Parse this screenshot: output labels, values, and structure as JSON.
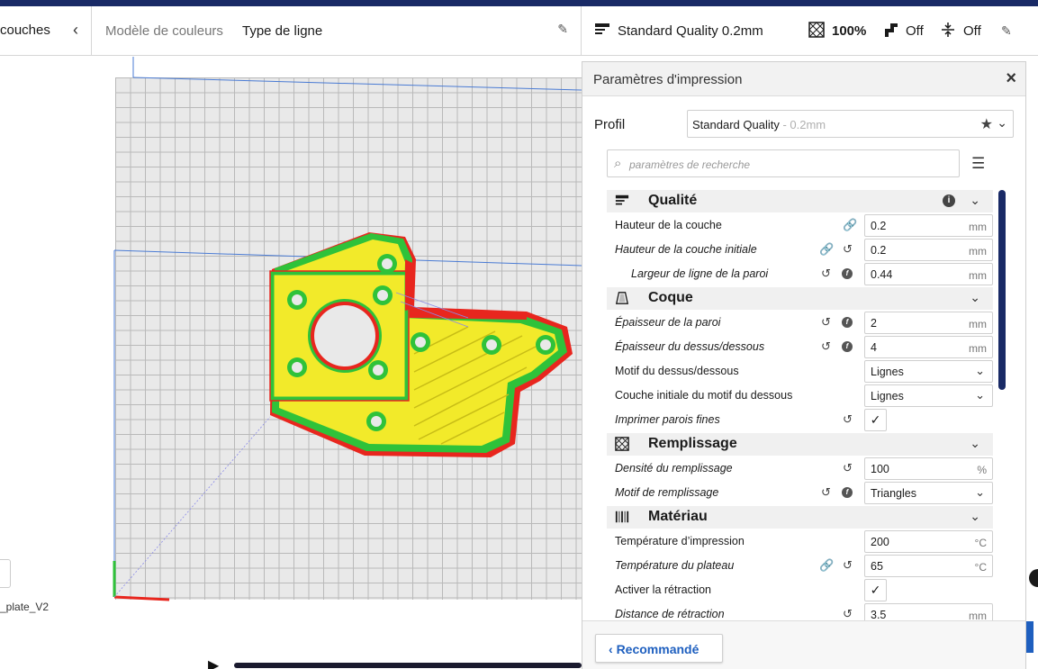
{
  "topbar": {
    "left_label": "couches",
    "color_scheme_label": "Modèle de couleurs",
    "color_scheme_value": "Type de ligne",
    "profile_label": "Standard Quality 0.2mm",
    "infill_value": "100%",
    "support_value": "Off",
    "adhesion_value": "Off"
  },
  "viewport": {
    "filename": "_plate_V2"
  },
  "panel": {
    "title": "Paramètres d'impression",
    "profil_label": "Profil",
    "profil_name": "Standard Quality",
    "profil_suffix": " - 0.2mm",
    "search_placeholder": "paramètres de recherche",
    "footer_button": "Recommandé"
  },
  "settings": {
    "qualite": {
      "label": "Qualité",
      "rows": [
        {
          "label": "Hauteur de la couche",
          "value": "0.2",
          "unit": "mm"
        },
        {
          "label": "Hauteur de la couche initiale",
          "value": "0.2",
          "unit": "mm"
        },
        {
          "label": "Largeur de ligne de la paroi",
          "value": "0.44",
          "unit": "mm"
        }
      ]
    },
    "coque": {
      "label": "Coque",
      "rows": [
        {
          "label": "Épaisseur de la paroi",
          "value": "2",
          "unit": "mm"
        },
        {
          "label": "Épaisseur du dessus/dessous",
          "value": "4",
          "unit": "mm"
        },
        {
          "label": "Motif du dessus/dessous",
          "value": "Lignes"
        },
        {
          "label": "Couche initiale du motif du dessous",
          "value": "Lignes"
        },
        {
          "label": "Imprimer parois fines",
          "value": "✓"
        }
      ]
    },
    "remplissage": {
      "label": "Remplissage",
      "rows": [
        {
          "label": "Densité du remplissage",
          "value": "100",
          "unit": "%"
        },
        {
          "label": "Motif de remplissage",
          "value": "Triangles"
        }
      ]
    },
    "materiau": {
      "label": "Matériau",
      "rows": [
        {
          "label": "Température d’impression",
          "value": "200",
          "unit": "°C"
        },
        {
          "label": "Température du plateau",
          "value": "65",
          "unit": "°C"
        },
        {
          "label": "Activer la rétraction",
          "value": "✓"
        },
        {
          "label": "Distance de rétraction",
          "value": "3.5",
          "unit": "mm"
        }
      ]
    }
  },
  "colors": {
    "accent": "#192a66",
    "link": "#1e5fbf",
    "print_yellow": "#f2ea2a",
    "print_green": "#2fc23a",
    "print_red": "#e8261e"
  }
}
